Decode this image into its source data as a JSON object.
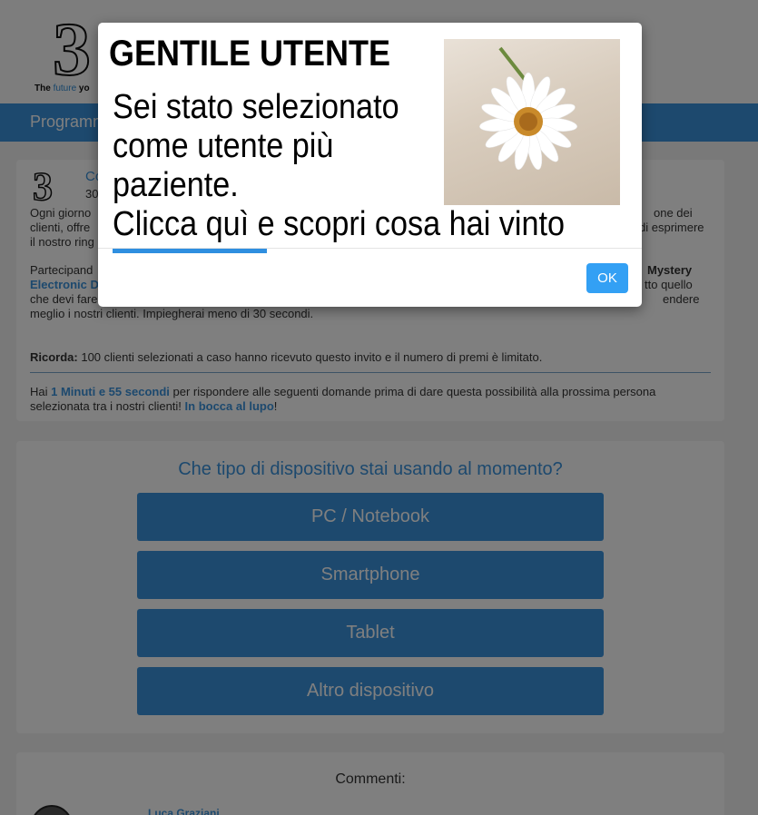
{
  "header": {
    "logo_digit": "3",
    "tagline_prefix": "The ",
    "tagline_future": "future",
    "tagline_suffix": " yo",
    "nav_title": "Programm"
  },
  "post": {
    "author": "Co",
    "date": "30",
    "para1_line1_left": "Ogni giorno",
    "para1_line1_right": "one dei",
    "para1_line2_left": "clienti, offre",
    "para1_line2_right": "di esprimere",
    "para1_line3": "il nostro ring",
    "para2_line1_left": "Partecipand",
    "para2_line1_right": "Mystery",
    "para2_line2_left": "Electronic D",
    "para2_line2_right": "tto quello",
    "para2_line3_left": "che devi fare",
    "para2_line3_right": "endere",
    "para2_line4": "meglio i nostri clienti. Impiegherai meno di 30 secondi.",
    "remember_label": "Ricorda:",
    "remember_text": " 100 clienti selezionati a caso hanno ricevuto questo invito e il numero di premi è limitato.",
    "timer_prefix": "Hai ",
    "timer_value": "1 Minuti e 55 secondi",
    "timer_suffix": " per rispondere alle seguenti domande prima di dare questa possibilità alla prossima persona selezionata tra i nostri clienti! ",
    "good_luck": "In bocca al lupo",
    "exclaim": "!"
  },
  "question": {
    "title": "Che tipo di dispositivo stai usando al momento?",
    "options": [
      "PC / Notebook",
      "Smartphone",
      "Tablet",
      "Altro dispositivo"
    ]
  },
  "comments": {
    "title": "Commenti:",
    "first_author": "Luca Graziani"
  },
  "modal": {
    "heading": "GENTILE UTENTE",
    "line1": "Sei stato selezionato",
    "line2": "come utente più",
    "line3": "paziente.",
    "line4": "Clicca quì e scopri cosa hai vinto",
    "ok_label": "OK",
    "progress": 0.3
  },
  "colors": {
    "accent": "#3a93dd",
    "ok_button": "#33a0f4",
    "overlay": "rgba(0,0,0,0.5)"
  }
}
